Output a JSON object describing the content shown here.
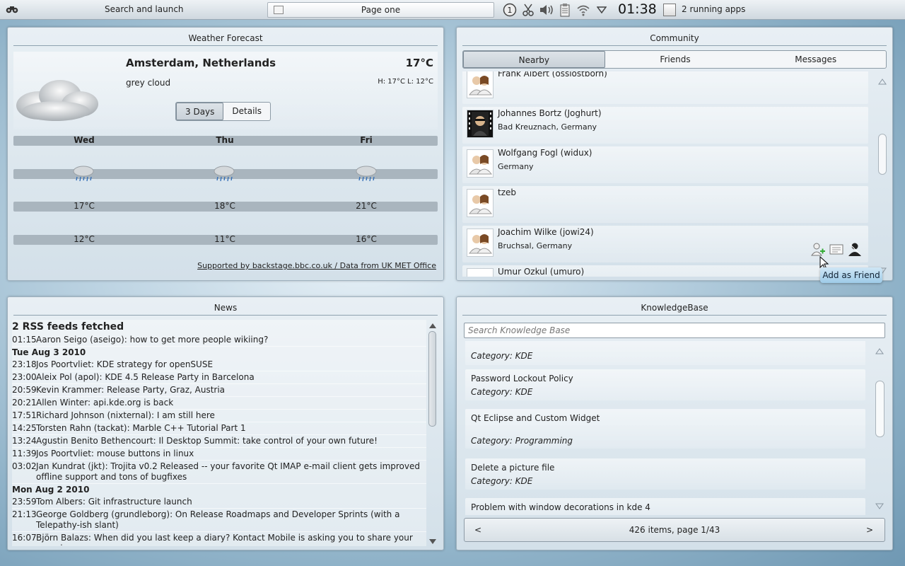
{
  "panel": {
    "launcher_label": "Search and launch",
    "page_label": "Page one",
    "notification_count": "1",
    "clock": "01:38",
    "running_apps": "2 running apps"
  },
  "weather": {
    "title": "Weather Forecast",
    "city": "Amsterdam, Netherlands",
    "temperature": "17°C",
    "condition": "grey cloud",
    "high_low": "H: 17°C L: 12°C",
    "tabs": [
      "3 Days",
      "Details"
    ],
    "days": [
      {
        "name": "Wed",
        "high": "17°C",
        "low": "12°C"
      },
      {
        "name": "Thu",
        "high": "18°C",
        "low": "11°C"
      },
      {
        "name": "Fri",
        "high": "21°C",
        "low": "16°C"
      }
    ],
    "footer": "Supported by backstage.bbc.co.uk / Data from UK MET Office"
  },
  "community": {
    "title": "Community",
    "tabs": [
      "Nearby",
      "Friends",
      "Messages"
    ],
    "people": [
      {
        "name": "Frank Albert (ossiostborn)",
        "location": ""
      },
      {
        "name": "Johannes Bortz (Joghurt)",
        "location": "Bad Kreuznach, Germany"
      },
      {
        "name": "Wolfgang Fogl (widux)",
        "location": "Germany"
      },
      {
        "name": "tzeb",
        "location": ""
      },
      {
        "name": "Joachim Wilke (jowi24)",
        "location": "Bruchsal, Germany"
      },
      {
        "name": "Umur Ozkul (umuro)",
        "location": ""
      }
    ],
    "tooltip": "Add as Friend"
  },
  "news": {
    "title": "News",
    "header": "2 RSS feeds fetched",
    "groups": [
      {
        "day": "",
        "items": [
          {
            "time": "01:15",
            "text": "Aaron Seigo (aseigo): how to get more people wikiing?"
          }
        ]
      },
      {
        "day": "Tue Aug 3 2010",
        "items": [
          {
            "time": "23:18",
            "text": "Jos Poortvliet: KDE strategy for openSUSE"
          },
          {
            "time": "23:00",
            "text": "Aleix Pol (apol): KDE 4.5 Release Party in Barcelona"
          },
          {
            "time": "20:59",
            "text": "Kevin Krammer: Release Party, Graz, Austria"
          },
          {
            "time": "20:21",
            "text": "Allen Winter: api.kde.org is back"
          },
          {
            "time": "17:51",
            "text": "Richard Johnson (nixternal): I am still here"
          },
          {
            "time": "14:25",
            "text": "Torsten Rahn (tackat): Marble C++ Tutorial Part 1"
          },
          {
            "time": "13:24",
            "text": "Agustin Benito Bethencourt: Il Desktop Summit: take control of your own future!"
          },
          {
            "time": "11:39",
            "text": "Jos Poortvliet: mouse buttons in linux"
          },
          {
            "time": "03:02",
            "text": "Jan Kundrat (jkt): Trojita v0.2 Released -- your favorite Qt IMAP e-mail client gets improved offline support and tons of bugfixes"
          }
        ]
      },
      {
        "day": "Mon Aug 2 2010",
        "items": [
          {
            "time": "23:59",
            "text": "Tom Albers: Git infrastructure launch"
          },
          {
            "time": "21:13",
            "text": "George Goldberg (grundleborg): On Release Roadmaps and Developer Sprints (with a Telepathy-ish slant)"
          },
          {
            "time": "16:07",
            "text": "Björn Balazs: When did you last keep a diary? Kontact Mobile is asking you to share your experience..."
          }
        ]
      }
    ]
  },
  "knowledgebase": {
    "title": "KnowledgeBase",
    "search_placeholder": "Search Knowledge Base",
    "items": [
      {
        "title": "",
        "category": "Category: KDE"
      },
      {
        "title": "Password Lockout Policy",
        "category": "Category: KDE"
      },
      {
        "title": "Qt Eclipse and Custom Widget",
        "category": "Category: Programming"
      },
      {
        "title": "Delete a picture file",
        "category": "Category: KDE"
      },
      {
        "title": "Problem with window decorations in kde 4",
        "category": ""
      }
    ],
    "pager": {
      "prev": "<",
      "label": "426 items, page 1/43",
      "next": ">"
    }
  }
}
